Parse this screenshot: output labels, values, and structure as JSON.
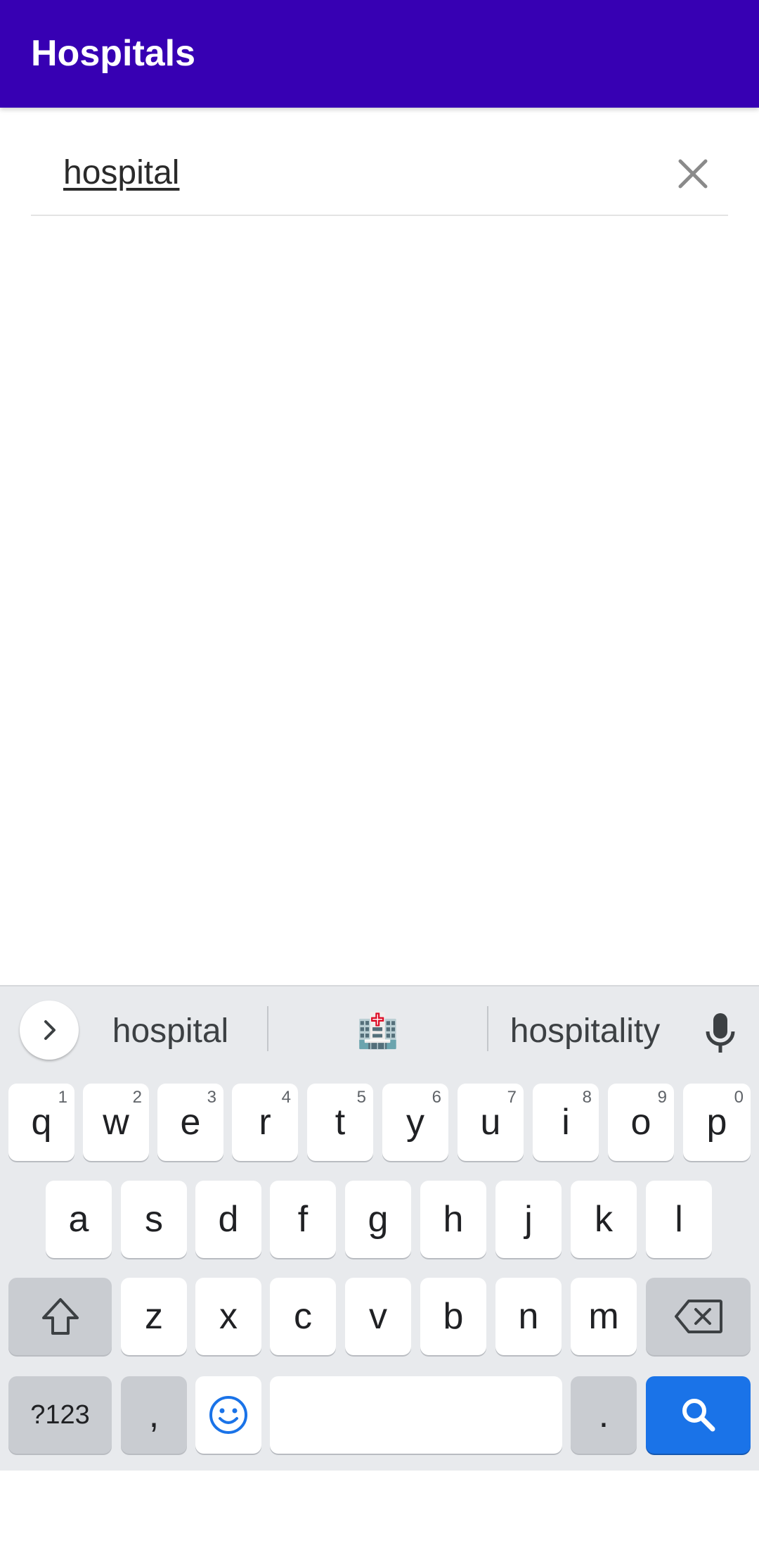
{
  "app_bar": {
    "title": "Hospitals",
    "color": "#3700B3"
  },
  "search": {
    "value": "hospital",
    "clear_icon": "close-icon"
  },
  "keyboard": {
    "suggestions": [
      "hospital",
      "🏥",
      "hospitality"
    ],
    "row1": [
      {
        "key": "q",
        "num": "1"
      },
      {
        "key": "w",
        "num": "2"
      },
      {
        "key": "e",
        "num": "3"
      },
      {
        "key": "r",
        "num": "4"
      },
      {
        "key": "t",
        "num": "5"
      },
      {
        "key": "y",
        "num": "6"
      },
      {
        "key": "u",
        "num": "7"
      },
      {
        "key": "i",
        "num": "8"
      },
      {
        "key": "o",
        "num": "9"
      },
      {
        "key": "p",
        "num": "0"
      }
    ],
    "row2": [
      "a",
      "s",
      "d",
      "f",
      "g",
      "h",
      "j",
      "k",
      "l"
    ],
    "row3": [
      "z",
      "x",
      "c",
      "v",
      "b",
      "n",
      "m"
    ],
    "bottom": {
      "symbols": "?123",
      "comma": ",",
      "period": "."
    },
    "accent_color": "#1a73e8"
  }
}
